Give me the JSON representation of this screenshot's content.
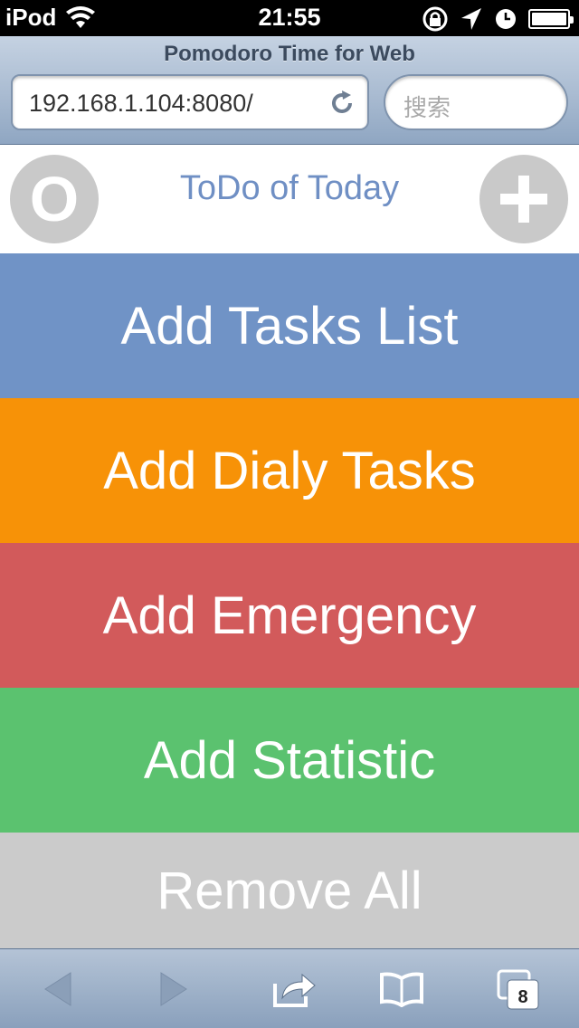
{
  "status_bar": {
    "carrier": "iPod",
    "time": "21:55"
  },
  "browser": {
    "page_title": "Pomodoro Time for Web",
    "url": "192.168.1.104:8080/",
    "search_placeholder": "搜索",
    "tabs_count": "8"
  },
  "app": {
    "left_button_label": "O",
    "title": "ToDo of Today"
  },
  "menu": [
    {
      "label": "Add Tasks List",
      "color": "#7093c6"
    },
    {
      "label": "Add Dialy Tasks",
      "color": "#f79207"
    },
    {
      "label": "Add Emergency",
      "color": "#d25a5b"
    },
    {
      "label": "Add Statistic",
      "color": "#5bc26f"
    },
    {
      "label": "Remove All",
      "color": "#cbcbcb"
    }
  ],
  "icons": {
    "status": [
      "wifi-icon",
      "rotation-lock-icon",
      "location-arrow-icon",
      "alarm-clock-icon",
      "battery-icon"
    ],
    "toolbar": [
      "back-arrow-icon",
      "forward-arrow-icon",
      "share-icon",
      "bookmarks-icon",
      "tabs-icon"
    ]
  }
}
